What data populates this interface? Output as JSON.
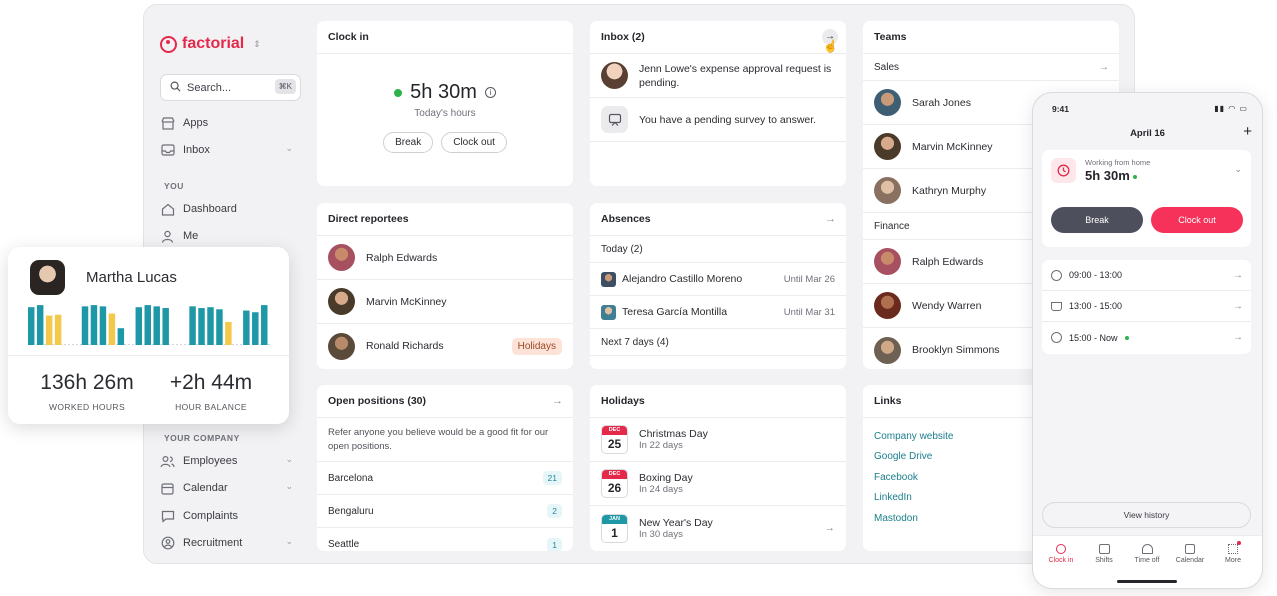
{
  "brand": {
    "name": "factorial",
    "switcher_icon": "chevron-updown-icon"
  },
  "colors": {
    "brand": "#e5294b",
    "teal": "#1e97a6",
    "yellow": "#f4c84a",
    "link": "#1b7f8c",
    "green": "#2fb24c"
  },
  "sidebar": {
    "search": {
      "placeholder": "Search...",
      "shortcut": "⌘K"
    },
    "top_items": [
      {
        "label": "Apps",
        "icon": "store-icon"
      },
      {
        "label": "Inbox",
        "icon": "inbox-icon"
      }
    ],
    "you_section": "YOU",
    "you_items": [
      {
        "label": "Dashboard",
        "icon": "home-icon"
      },
      {
        "label": "Me",
        "icon": "user-icon"
      }
    ],
    "company_section": "YOUR COMPANY",
    "company_items": [
      {
        "label": "Employees",
        "icon": "people-icon"
      },
      {
        "label": "Calendar",
        "icon": "calendar-icon"
      },
      {
        "label": "Complaints",
        "icon": "chat-icon"
      },
      {
        "label": "Recruitment",
        "icon": "recruit-icon"
      }
    ]
  },
  "clock_in": {
    "title": "Clock in",
    "time": "5h 30m",
    "caption": "Today's hours",
    "break_label": "Break",
    "clock_out_label": "Clock out"
  },
  "inbox": {
    "title": "Inbox (2)",
    "items": [
      "Jenn Lowe's expense approval request is pending.",
      "You have a pending survey to answer."
    ]
  },
  "teams": {
    "title": "Teams",
    "groups": [
      {
        "name": "Sales",
        "members": [
          "Sarah Jones",
          "Marvin McKinney",
          "Kathryn Murphy"
        ]
      },
      {
        "name": "Finance",
        "members": [
          "Ralph Edwards",
          "Wendy Warren",
          "Brooklyn Simmons"
        ]
      }
    ]
  },
  "direct_reportees": {
    "title": "Direct reportees",
    "people": [
      {
        "name": "Ralph Edwards",
        "tag": ""
      },
      {
        "name": "Marvin McKinney",
        "tag": ""
      },
      {
        "name": "Ronald Richards",
        "tag": "Holidays"
      }
    ]
  },
  "absences": {
    "title": "Absences",
    "today_label": "Today (2)",
    "today": [
      {
        "name": "Alejandro Castillo Moreno",
        "until": "Until Mar 26"
      },
      {
        "name": "Teresa García Montilla",
        "until": "Until Mar 31"
      }
    ],
    "next_label": "Next 7 days (4)"
  },
  "open_positions": {
    "title": "Open positions (30)",
    "description": "Refer anyone you believe would be a good fit for our open positions.",
    "cities": [
      {
        "name": "Barcelona",
        "count": "21"
      },
      {
        "name": "Bengaluru",
        "count": "2"
      },
      {
        "name": "Seattle",
        "count": "1"
      }
    ]
  },
  "holidays": {
    "title": "Holidays",
    "items": [
      {
        "month": "DEC",
        "day": "25",
        "name": "Christmas Day",
        "when": "In 22 days"
      },
      {
        "month": "DEC",
        "day": "26",
        "name": "Boxing Day",
        "when": "In 24 days"
      },
      {
        "month": "JAN",
        "day": "1",
        "name": "New Year's Day",
        "when": "In 30 days"
      }
    ]
  },
  "links": {
    "title": "Links",
    "items": [
      "Company website",
      "Google Drive",
      "Facebook",
      "LinkedIn",
      "Mastodon"
    ]
  },
  "martha": {
    "name": "Martha Lucas",
    "worked": "136h 26m",
    "worked_label": "WORKED HOURS",
    "balance": "+2h 44m",
    "balance_label": "HOUR BALANCE",
    "bars": [
      {
        "v": 0.9,
        "c": "teal"
      },
      {
        "v": 0.95,
        "c": "teal"
      },
      {
        "v": 0.7,
        "c": "yellow"
      },
      {
        "v": 0.72,
        "c": "yellow"
      },
      {
        "v": 0,
        "c": "none"
      },
      {
        "v": 0,
        "c": "none"
      },
      {
        "v": 0.92,
        "c": "teal"
      },
      {
        "v": 0.95,
        "c": "teal"
      },
      {
        "v": 0.92,
        "c": "teal"
      },
      {
        "v": 0.75,
        "c": "yellow"
      },
      {
        "v": 0.4,
        "c": "teal"
      },
      {
        "v": 0,
        "c": "none"
      },
      {
        "v": 0.9,
        "c": "teal"
      },
      {
        "v": 0.95,
        "c": "teal"
      },
      {
        "v": 0.92,
        "c": "teal"
      },
      {
        "v": 0.88,
        "c": "teal"
      },
      {
        "v": 0,
        "c": "none"
      },
      {
        "v": 0,
        "c": "none"
      },
      {
        "v": 0.92,
        "c": "teal"
      },
      {
        "v": 0.88,
        "c": "teal"
      },
      {
        "v": 0.9,
        "c": "teal"
      },
      {
        "v": 0.85,
        "c": "teal"
      },
      {
        "v": 0.55,
        "c": "yellow"
      },
      {
        "v": 0,
        "c": "none"
      },
      {
        "v": 0.82,
        "c": "teal"
      },
      {
        "v": 0.78,
        "c": "teal"
      },
      {
        "v": 0.95,
        "c": "teal"
      }
    ]
  },
  "phone": {
    "status_time": "9:41",
    "date": "April 16",
    "status_label": "Working from home",
    "time": "5h 30m",
    "break_label": "Break",
    "clock_out_label": "Clock out",
    "entries": [
      {
        "icon": "clock-icon",
        "label": "09:00 - 13:00"
      },
      {
        "icon": "coffee-icon",
        "label": "13:00 - 15:00"
      },
      {
        "icon": "clock-icon",
        "label": "15:00 - Now"
      }
    ],
    "view_history": "View history",
    "tabs": [
      {
        "label": "Clock in",
        "active": true
      },
      {
        "label": "Shifts"
      },
      {
        "label": "Time off"
      },
      {
        "label": "Calendar"
      },
      {
        "label": "More"
      }
    ]
  }
}
